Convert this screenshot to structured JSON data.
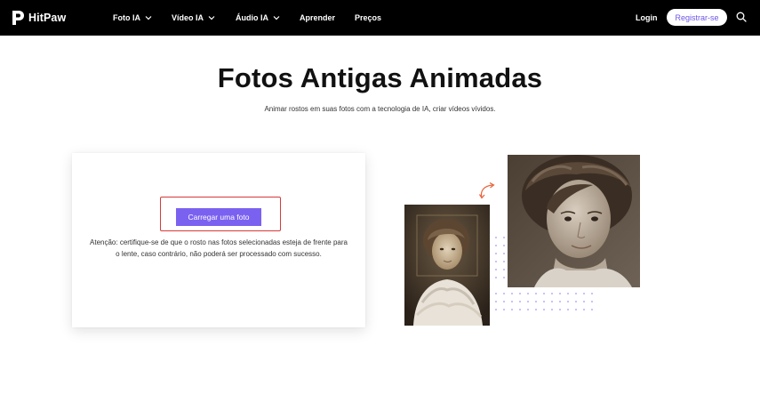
{
  "header": {
    "brand": "HitPaw",
    "nav": [
      {
        "label": "Foto IA",
        "has_dropdown": true
      },
      {
        "label": "Vídeo IA",
        "has_dropdown": true
      },
      {
        "label": "Áudio IA",
        "has_dropdown": true
      },
      {
        "label": "Aprender",
        "has_dropdown": false
      },
      {
        "label": "Preços",
        "has_dropdown": false
      }
    ],
    "login_label": "Login",
    "register_label": "Registrar-se",
    "icons": {
      "logo": "hitpaw-logo-icon",
      "search": "search-icon",
      "dropdown": "chevron-down-icon"
    }
  },
  "hero": {
    "title": "Fotos Antigas Animadas",
    "subtitle": "Animar rostos em suas fotos com a tecnologia de IA, criar vídeos vívidos."
  },
  "upload": {
    "button_label": "Carregar uma foto",
    "notice": "Atenção: certifique-se de que o rosto nas fotos selecionadas esteja de frente para o lente, caso contrário, não poderá ser processado com sucesso."
  },
  "colors": {
    "header_bg": "#000000",
    "accent": "#7b61f0",
    "highlight": "#d63a3a",
    "arrow": "#e8623a",
    "dots": "#b9aef5"
  }
}
